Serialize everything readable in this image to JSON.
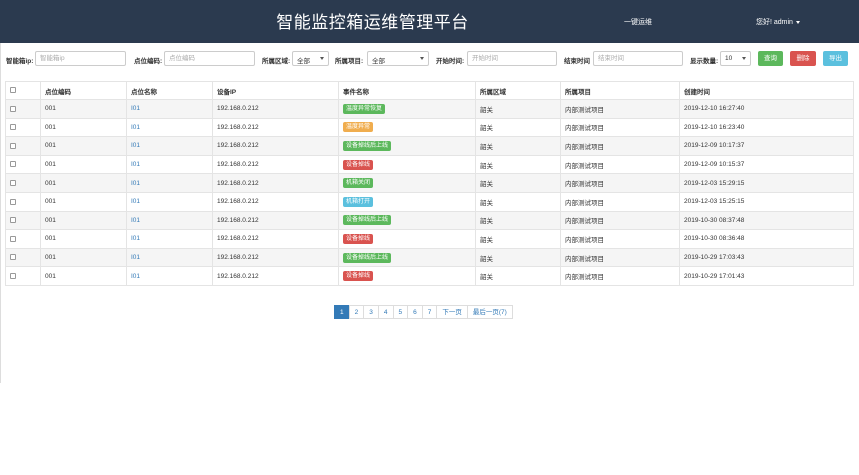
{
  "header": {
    "title": "智能监控箱运维管理平台",
    "one_click": "一键运维",
    "greeting": "您好! admin"
  },
  "filters": {
    "box_ip_label": "智能箱ip:",
    "box_ip_placeholder": "智能箱ip",
    "point_code_label": "点位编码:",
    "point_code_placeholder": "点位编码",
    "area_label": "所属区域:",
    "area_value": "全部",
    "project_label": "所属项目:",
    "project_value": "全部",
    "start_label": "开始时间:",
    "start_placeholder": "开始时间",
    "end_label": "结束时间",
    "end_placeholder": "结束时间",
    "count_label": "显示数量:",
    "count_value": "10",
    "query_btn": "查询",
    "delete_btn": "删除",
    "export_btn": "导出"
  },
  "table": {
    "columns": [
      "点位编码",
      "点位名称",
      "设备IP",
      "事件名称",
      "所属区域",
      "所属项目",
      "创建时间"
    ],
    "rows": [
      {
        "code": "001",
        "name": "I01",
        "ip": "192.168.0.212",
        "event": "温度异常恢复",
        "event_color": "#5cb85c",
        "area": "韶关",
        "project": "内部测试项目",
        "time": "2019-12-10 16:27:40"
      },
      {
        "code": "001",
        "name": "I01",
        "ip": "192.168.0.212",
        "event": "温度异常",
        "event_color": "#f0ad4e",
        "area": "韶关",
        "project": "内部测试项目",
        "time": "2019-12-10 16:23:40"
      },
      {
        "code": "001",
        "name": "I01",
        "ip": "192.168.0.212",
        "event": "设备掉线后上线",
        "event_color": "#5cb85c",
        "area": "韶关",
        "project": "内部测试项目",
        "time": "2019-12-09 10:17:37"
      },
      {
        "code": "001",
        "name": "I01",
        "ip": "192.168.0.212",
        "event": "设备掉线",
        "event_color": "#d9534f",
        "area": "韶关",
        "project": "内部测试项目",
        "time": "2019-12-09 10:15:37"
      },
      {
        "code": "001",
        "name": "I01",
        "ip": "192.168.0.212",
        "event": "机箱关闭",
        "event_color": "#5cb85c",
        "area": "韶关",
        "project": "内部测试项目",
        "time": "2019-12-03 15:29:15"
      },
      {
        "code": "001",
        "name": "I01",
        "ip": "192.168.0.212",
        "event": "机箱打开",
        "event_color": "#5bc0de",
        "area": "韶关",
        "project": "内部测试项目",
        "time": "2019-12-03 15:25:15"
      },
      {
        "code": "001",
        "name": "I01",
        "ip": "192.168.0.212",
        "event": "设备掉线后上线",
        "event_color": "#5cb85c",
        "area": "韶关",
        "project": "内部测试项目",
        "time": "2019-10-30 08:37:48"
      },
      {
        "code": "001",
        "name": "I01",
        "ip": "192.168.0.212",
        "event": "设备掉线",
        "event_color": "#d9534f",
        "area": "韶关",
        "project": "内部测试项目",
        "time": "2019-10-30 08:36:48"
      },
      {
        "code": "001",
        "name": "I01",
        "ip": "192.168.0.212",
        "event": "设备掉线后上线",
        "event_color": "#5cb85c",
        "area": "韶关",
        "project": "内部测试项目",
        "time": "2019-10-29 17:03:43"
      },
      {
        "code": "001",
        "name": "I01",
        "ip": "192.168.0.212",
        "event": "设备掉线",
        "event_color": "#d9534f",
        "area": "韶关",
        "project": "内部测试项目",
        "time": "2019-10-29 17:01:43"
      }
    ]
  },
  "pagination": {
    "pages": [
      "1",
      "2",
      "3",
      "4",
      "5",
      "6",
      "7"
    ],
    "active": "1",
    "next": "下一页",
    "last": "最后一页(7)"
  }
}
